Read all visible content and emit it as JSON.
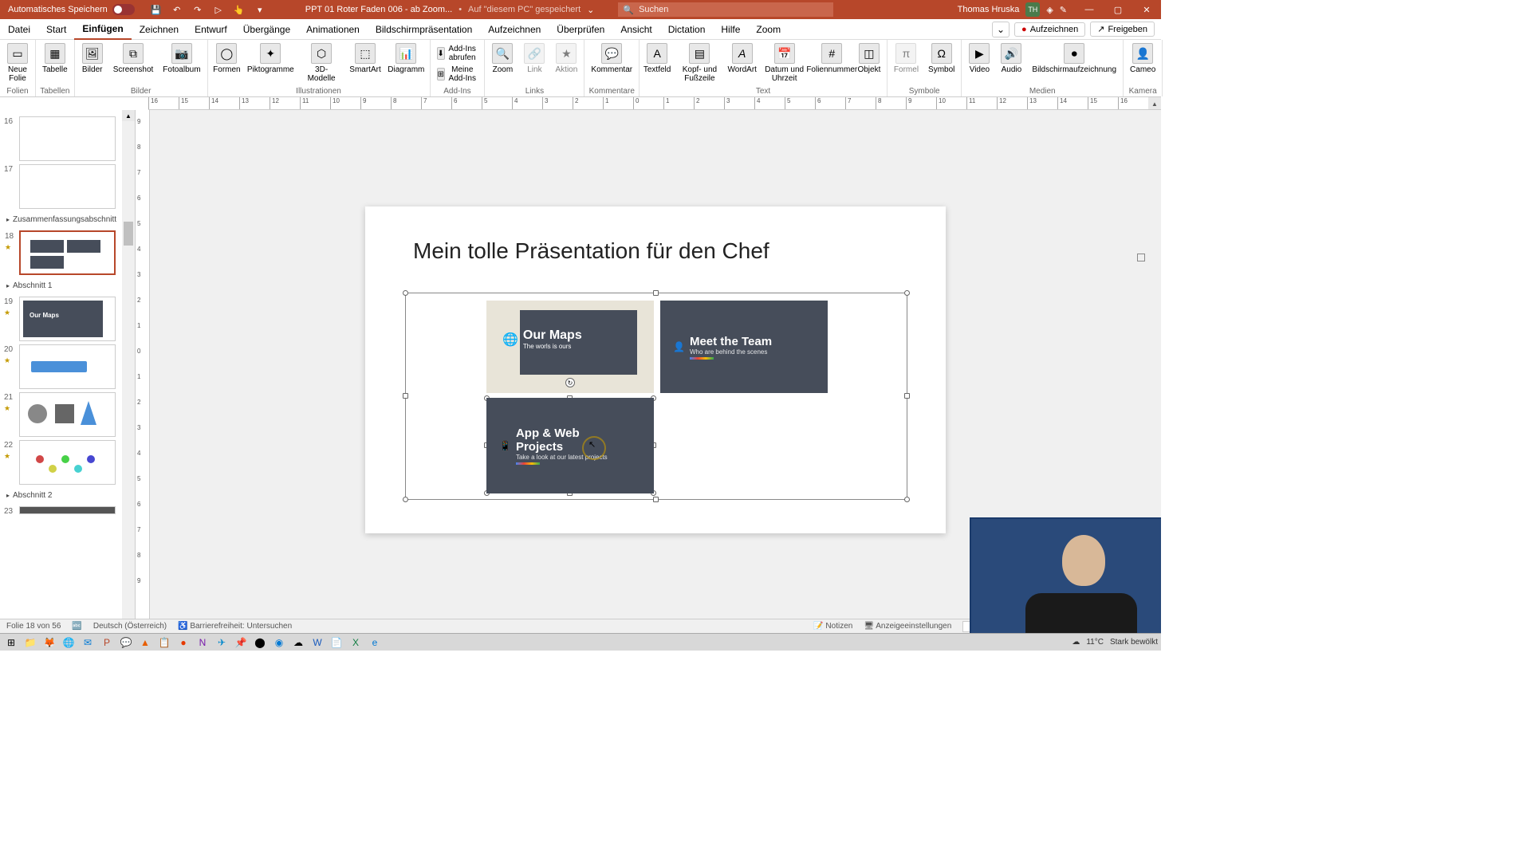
{
  "titlebar": {
    "autosave": "Automatisches Speichern",
    "docname": "PPT 01 Roter Faden 006 - ab Zoom...",
    "saved": "Auf \"diesem PC\" gespeichert",
    "search_placeholder": "Suchen",
    "username": "Thomas Hruska",
    "userinitials": "TH"
  },
  "menu": {
    "tabs": [
      "Datei",
      "Start",
      "Einfügen",
      "Zeichnen",
      "Entwurf",
      "Übergänge",
      "Animationen",
      "Bildschirmpräsentation",
      "Aufzeichnen",
      "Überprüfen",
      "Ansicht",
      "Dictation",
      "Hilfe",
      "Zoom"
    ],
    "active": 2,
    "record": "Aufzeichnen",
    "share": "Freigeben"
  },
  "ribbon": {
    "groups": {
      "folien": "Folien",
      "tabellen": "Tabellen",
      "bilder": "Bilder",
      "illustrationen": "Illustrationen",
      "addins": "Add-Ins",
      "links": "Links",
      "kommentare": "Kommentare",
      "text": "Text",
      "symbole": "Symbole",
      "medien": "Medien",
      "kamera": "Kamera"
    },
    "btns": {
      "neuefolie": "Neue\nFolie",
      "tabelle": "Tabelle",
      "bilder": "Bilder",
      "screenshot": "Screenshot",
      "fotoalbum": "Fotoalbum",
      "formen": "Formen",
      "piktogramme": "Piktogramme",
      "modelle3d": "3D-\nModelle",
      "smartart": "SmartArt",
      "diagramm": "Diagramm",
      "addins_abrufen": "Add-Ins abrufen",
      "meine_addins": "Meine Add-Ins",
      "zoom": "Zoom",
      "link": "Link",
      "aktion": "Aktion",
      "kommentar": "Kommentar",
      "textfeld": "Textfeld",
      "kopfzeile": "Kopf- und\nFußzeile",
      "wordart": "WordArt",
      "datum": "Datum und\nUhrzeit",
      "foliennummer": "Foliennummer",
      "objekt": "Objekt",
      "formel": "Formel",
      "symbol": "Symbol",
      "video": "Video",
      "audio": "Audio",
      "bildschirmaufz": "Bildschirmaufzeichnung",
      "cameo": "Cameo"
    }
  },
  "slidepanel": {
    "thumbs": [
      {
        "num": "16"
      },
      {
        "num": "17"
      }
    ],
    "section_summary": "Zusammenfassungsabschnitt",
    "thumb18": {
      "num": "18"
    },
    "section1": "Abschnitt 1",
    "thumbs2": [
      {
        "num": "19"
      },
      {
        "num": "20"
      },
      {
        "num": "21"
      },
      {
        "num": "22"
      }
    ],
    "section2": "Abschnitt 2",
    "thumb23": {
      "num": "23"
    }
  },
  "slide": {
    "title": "Mein tolle Präsentation für den Chef",
    "cards": {
      "maps": {
        "title": "Our Maps",
        "sub": "The worls is ours"
      },
      "team": {
        "title": "Meet the Team",
        "sub": "Who are behind the scenes"
      },
      "app": {
        "title": "App & Web\nProjects",
        "sub": "Take a look at our latest projects"
      }
    }
  },
  "statusbar": {
    "slidecount": "Folie 18 von 56",
    "lang": "Deutsch (Österreich)",
    "access": "Barrierefreiheit: Untersuchen",
    "notes": "Notizen",
    "display": "Anzeigeeinstellungen"
  },
  "taskbar": {
    "weather_temp": "11°C",
    "weather_text": "Stark bewölkt"
  },
  "ruler_h": [
    "16",
    "15",
    "14",
    "13",
    "12",
    "11",
    "10",
    "9",
    "8",
    "7",
    "6",
    "5",
    "4",
    "3",
    "2",
    "1",
    "0",
    "1",
    "2",
    "3",
    "4",
    "5",
    "6",
    "7",
    "8",
    "9",
    "10",
    "11",
    "12",
    "13",
    "14",
    "15",
    "16"
  ],
  "ruler_v": [
    "9",
    "8",
    "7",
    "6",
    "5",
    "4",
    "3",
    "2",
    "1",
    "0",
    "1",
    "2",
    "3",
    "4",
    "5",
    "6",
    "7",
    "8",
    "9"
  ]
}
